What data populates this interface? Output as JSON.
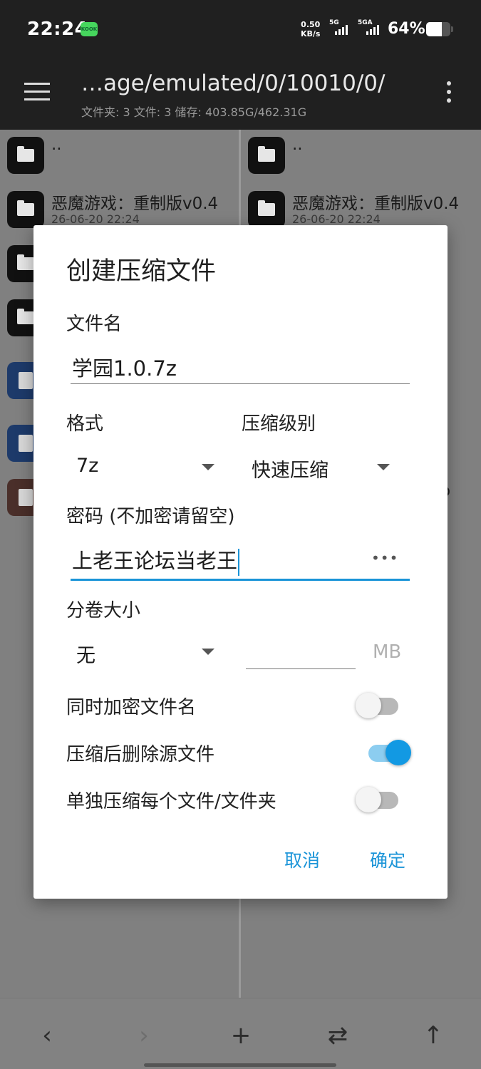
{
  "status_bar": {
    "time": "22:24",
    "app_badge": "KOOK",
    "net_speed_value": "0.50",
    "net_speed_unit": "KB/s",
    "signal1_label": "5G",
    "signal2_label": "5GA",
    "battery_percent_text": "64%",
    "battery_level": 0.64
  },
  "toolbar": {
    "path": "…age/emulated/0/10010/0/",
    "info": "文件夹: 3  文件: 3  储存: 403.85G/462.31G"
  },
  "left_pane": {
    "items": [
      {
        "name": "..",
        "date": ""
      },
      {
        "name": "恶魔游戏：重制版v0.4",
        "date": "26-06-20 22:24"
      }
    ]
  },
  "right_pane": {
    "items": [
      {
        "name": "..",
        "date": ""
      },
      {
        "name": "恶魔游戏：重制版v0.4",
        "date": "26-06-20 22:24"
      },
      {
        "name": "",
        "date": ""
      },
      {
        "name": "",
        "date": ""
      },
      {
        "name": "",
        "date": ""
      },
      {
        "name": "",
        "date": ""
      },
      {
        "name": "o",
        "date": ""
      }
    ]
  },
  "dialog": {
    "title": "创建压缩文件",
    "filename_label": "文件名",
    "filename_value": "学园1.0.7z",
    "format_label": "格式",
    "format_value": "7z",
    "level_label": "压缩级别",
    "level_value": "快速压缩",
    "password_label": "密码 (不加密请留空)",
    "password_value": "上老王论坛当老王",
    "password_toggle": "•••",
    "split_label": "分卷大小",
    "split_value": "无",
    "split_size_value": "",
    "split_unit": "MB",
    "encrypt_names_label": "同时加密文件名",
    "encrypt_names_on": false,
    "delete_source_label": "压缩后删除源文件",
    "delete_source_on": true,
    "separate_label": "单独压缩每个文件/文件夹",
    "separate_on": false,
    "cancel_label": "取消",
    "ok_label": "确定"
  },
  "bottom_nav": {
    "back_icon": "‹",
    "forward_icon": "›",
    "add_icon": "+",
    "swap_icon": "⇄",
    "up_icon": "↑"
  }
}
